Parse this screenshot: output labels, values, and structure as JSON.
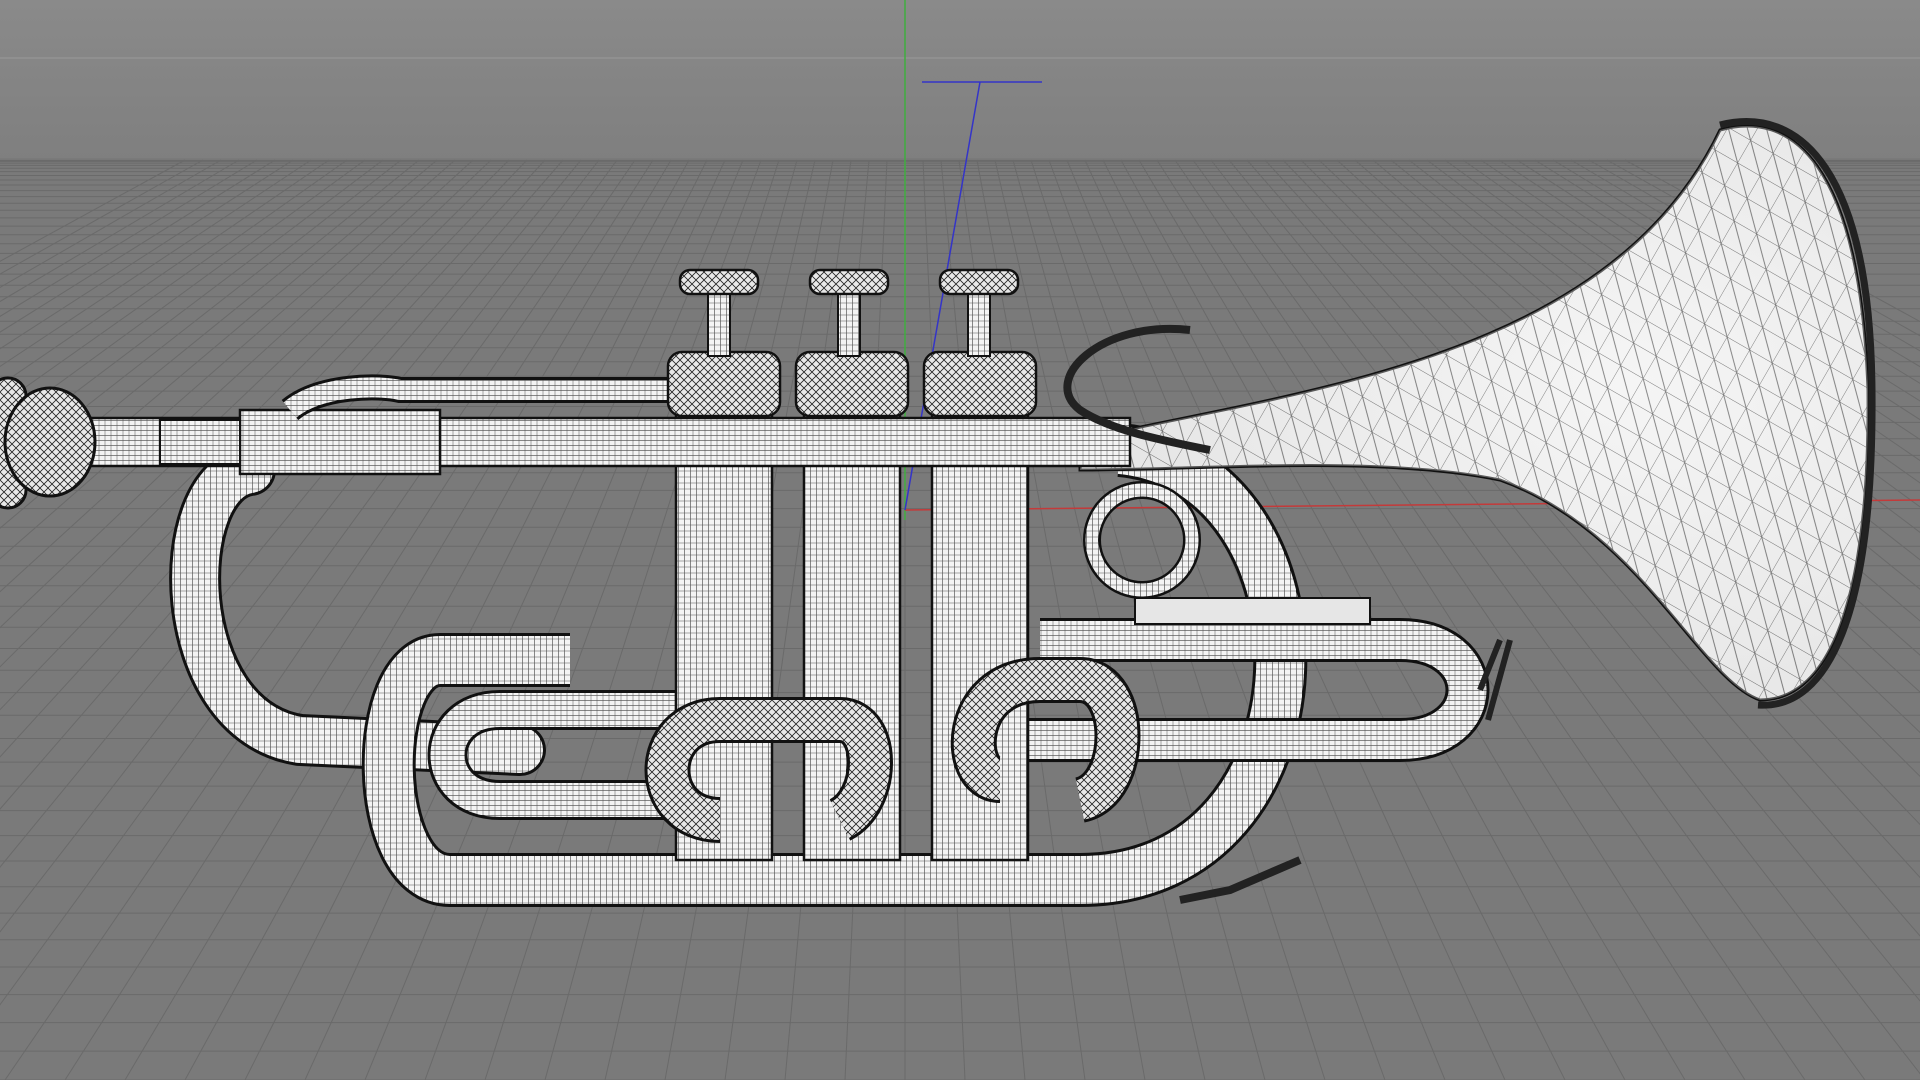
{
  "viewport": {
    "background_color": "#7a7a7a",
    "sky_color": "#858585",
    "grid_color": "#6a6a6a",
    "axis_colors": {
      "x": "#c43a3a",
      "y": "#3fae3f",
      "z": "#3434c8"
    },
    "object": "trumpet",
    "display_mode": "wireframe"
  }
}
